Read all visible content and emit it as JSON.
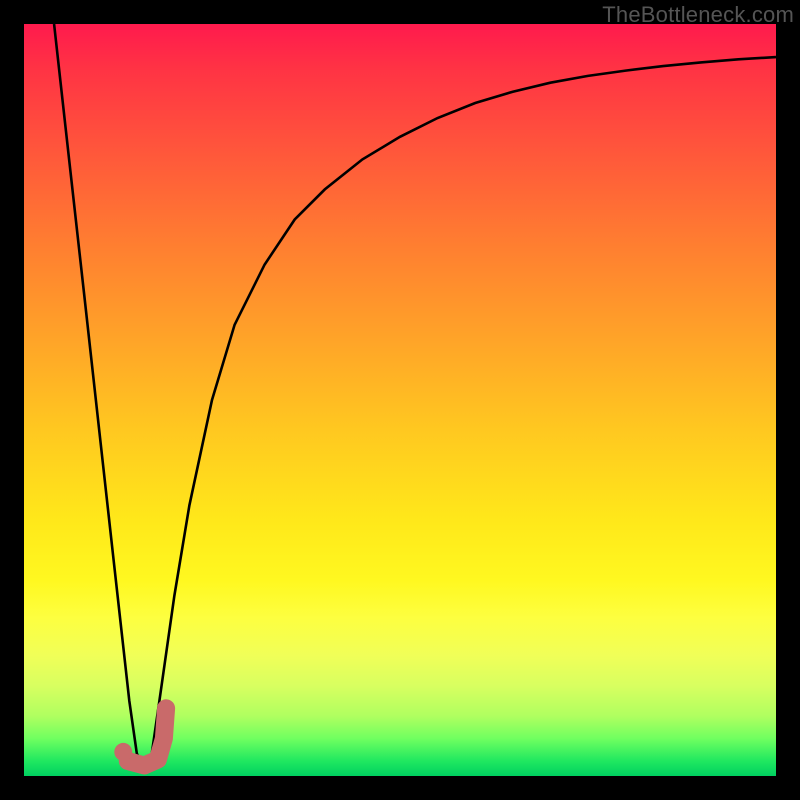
{
  "watermark": "TheBottleneck.com",
  "colors": {
    "frame_bg_top": "#ff1a4d",
    "frame_bg_bottom": "#00d060",
    "border": "#000000",
    "curve": "#000000",
    "marker": "#c96a6a",
    "watermark_text": "#555555"
  },
  "chart_data": {
    "type": "line",
    "title": "",
    "xlabel": "",
    "ylabel": "",
    "xlim": [
      0,
      100
    ],
    "ylim": [
      0,
      100
    ],
    "annotations": [
      "TheBottleneck.com"
    ],
    "series": [
      {
        "name": "curve",
        "x": [
          4,
          6,
          8,
          10,
          12,
          14,
          15,
          16,
          17,
          18,
          20,
          22,
          25,
          28,
          32,
          36,
          40,
          45,
          50,
          55,
          60,
          65,
          70,
          75,
          80,
          85,
          90,
          95,
          100
        ],
        "y": [
          100,
          82,
          64,
          46,
          28,
          10,
          3,
          1,
          3,
          10,
          24,
          36,
          50,
          60,
          68,
          74,
          78,
          82,
          85,
          87.5,
          89.5,
          91,
          92.2,
          93.1,
          93.8,
          94.4,
          94.9,
          95.3,
          95.6
        ]
      }
    ],
    "marker": {
      "shape": "J",
      "dot": {
        "x": 13.2,
        "y": 3.2
      },
      "hook": [
        {
          "x": 13.8,
          "y": 2.0
        },
        {
          "x": 16.0,
          "y": 1.4
        },
        {
          "x": 17.8,
          "y": 2.2
        },
        {
          "x": 18.6,
          "y": 5.0
        },
        {
          "x": 18.9,
          "y": 9.0
        }
      ]
    }
  }
}
